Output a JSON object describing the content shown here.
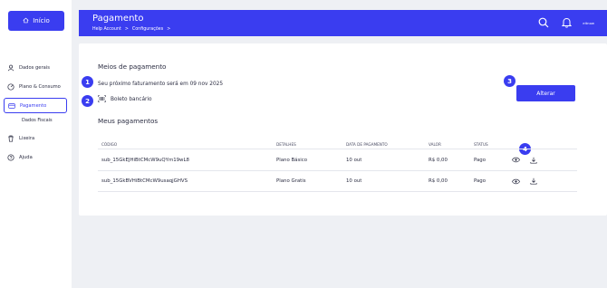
{
  "sidebar": {
    "home_label": "Início",
    "items": [
      {
        "label": "Dados gerais",
        "icon": "user-icon"
      },
      {
        "label": "Plano & Consumo",
        "icon": "dashboard-icon"
      },
      {
        "label": "Pagamento",
        "icon": "credit-card-icon"
      },
      {
        "label": "Lixeira",
        "icon": "trash-icon"
      },
      {
        "label": "Ajuda",
        "icon": "help-icon"
      }
    ],
    "sub_item": "Dados Fiscais"
  },
  "header": {
    "title": "Pagamento",
    "breadcrumb": [
      "Help Account",
      ">",
      "Configurações",
      ">"
    ],
    "user_label": "eitnow"
  },
  "payment_methods": {
    "title": "Meios de pagamento",
    "next_billing": "Seu próximo faturamento será em 09 nov 2025",
    "method": "Boleto bancário",
    "change_button": "Alterar"
  },
  "badges": [
    "1",
    "2",
    "3",
    "4"
  ],
  "payments": {
    "title": "Meus pagamentos",
    "columns": [
      "CÓDIGO",
      "DETALHES",
      "DATA DE PAGAMENTO",
      "VALOR",
      "STATUS"
    ],
    "rows": [
      {
        "code": "sub_15GkEJHiBtCMcW9uQYm19wL8",
        "details": "Plano Básico",
        "date": "10 out",
        "value": "R$ 0,00",
        "status": "Pago"
      },
      {
        "code": "sub_15GkBVHiBtCMcW9usaqjGHVS",
        "details": "Plano Gratis",
        "date": "10 out",
        "value": "R$ 0,00",
        "status": "Pago"
      }
    ]
  },
  "colors": {
    "accent": "#3a3df0",
    "background": "#eef0f4"
  }
}
